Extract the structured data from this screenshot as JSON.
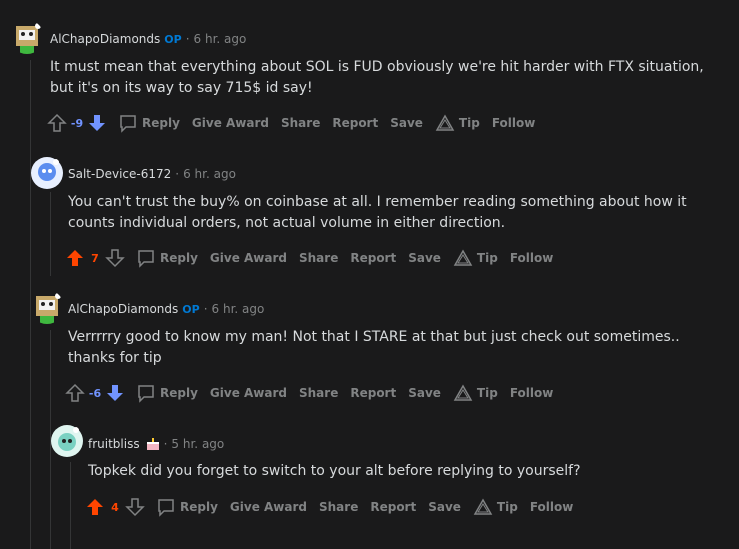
{
  "comments": [
    {
      "username": "AlChapoDiamonds",
      "op_badge": "OP",
      "separator": "·",
      "time": "6 hr. ago",
      "lines": [
        "It must mean that everything about SOL is FUD obviously we're hit harder with FTX situation,",
        "but it's on its way to say 715$ id say!"
      ],
      "score": "-9",
      "vote_state": "down"
    },
    {
      "username": "Salt-Device-6172",
      "separator": "·",
      "time": "6 hr. ago",
      "lines": [
        "You can't trust the buy% on coinbase at all. I remember reading something about how it",
        "counts individual orders, not actual volume in either direction."
      ],
      "score": "7",
      "vote_state": "up"
    },
    {
      "username": "AlChapoDiamonds",
      "op_badge": "OP",
      "separator": "·",
      "time": "6 hr. ago",
      "lines": [
        "Verrrrry good to know my man! Not that I STARE at that but just check out sometimes..",
        "thanks for tip"
      ],
      "score": "-6",
      "vote_state": "down"
    },
    {
      "username": "fruitbliss",
      "separator": "·",
      "time": "5 hr. ago",
      "lines": [
        "Topkek did you forget to switch to your alt before replying to yourself?"
      ],
      "score": "4",
      "vote_state": "up"
    }
  ],
  "actions": {
    "reply": "Reply",
    "give_award": "Give Award",
    "share": "Share",
    "report": "Report",
    "save": "Save",
    "tip": "Tip",
    "follow": "Follow"
  },
  "colors": {
    "background": "#1a1a1b",
    "upvote": "#ff4500",
    "downvote": "#7193ff",
    "op": "#0079d3",
    "muted": "#818384",
    "text": "#d7dadc"
  },
  "icons": [
    "upvote-arrow-icon",
    "downvote-arrow-icon",
    "comment-bubble-icon",
    "tip-triangle-icon",
    "avatar-icon",
    "flair-cake-icon"
  ]
}
